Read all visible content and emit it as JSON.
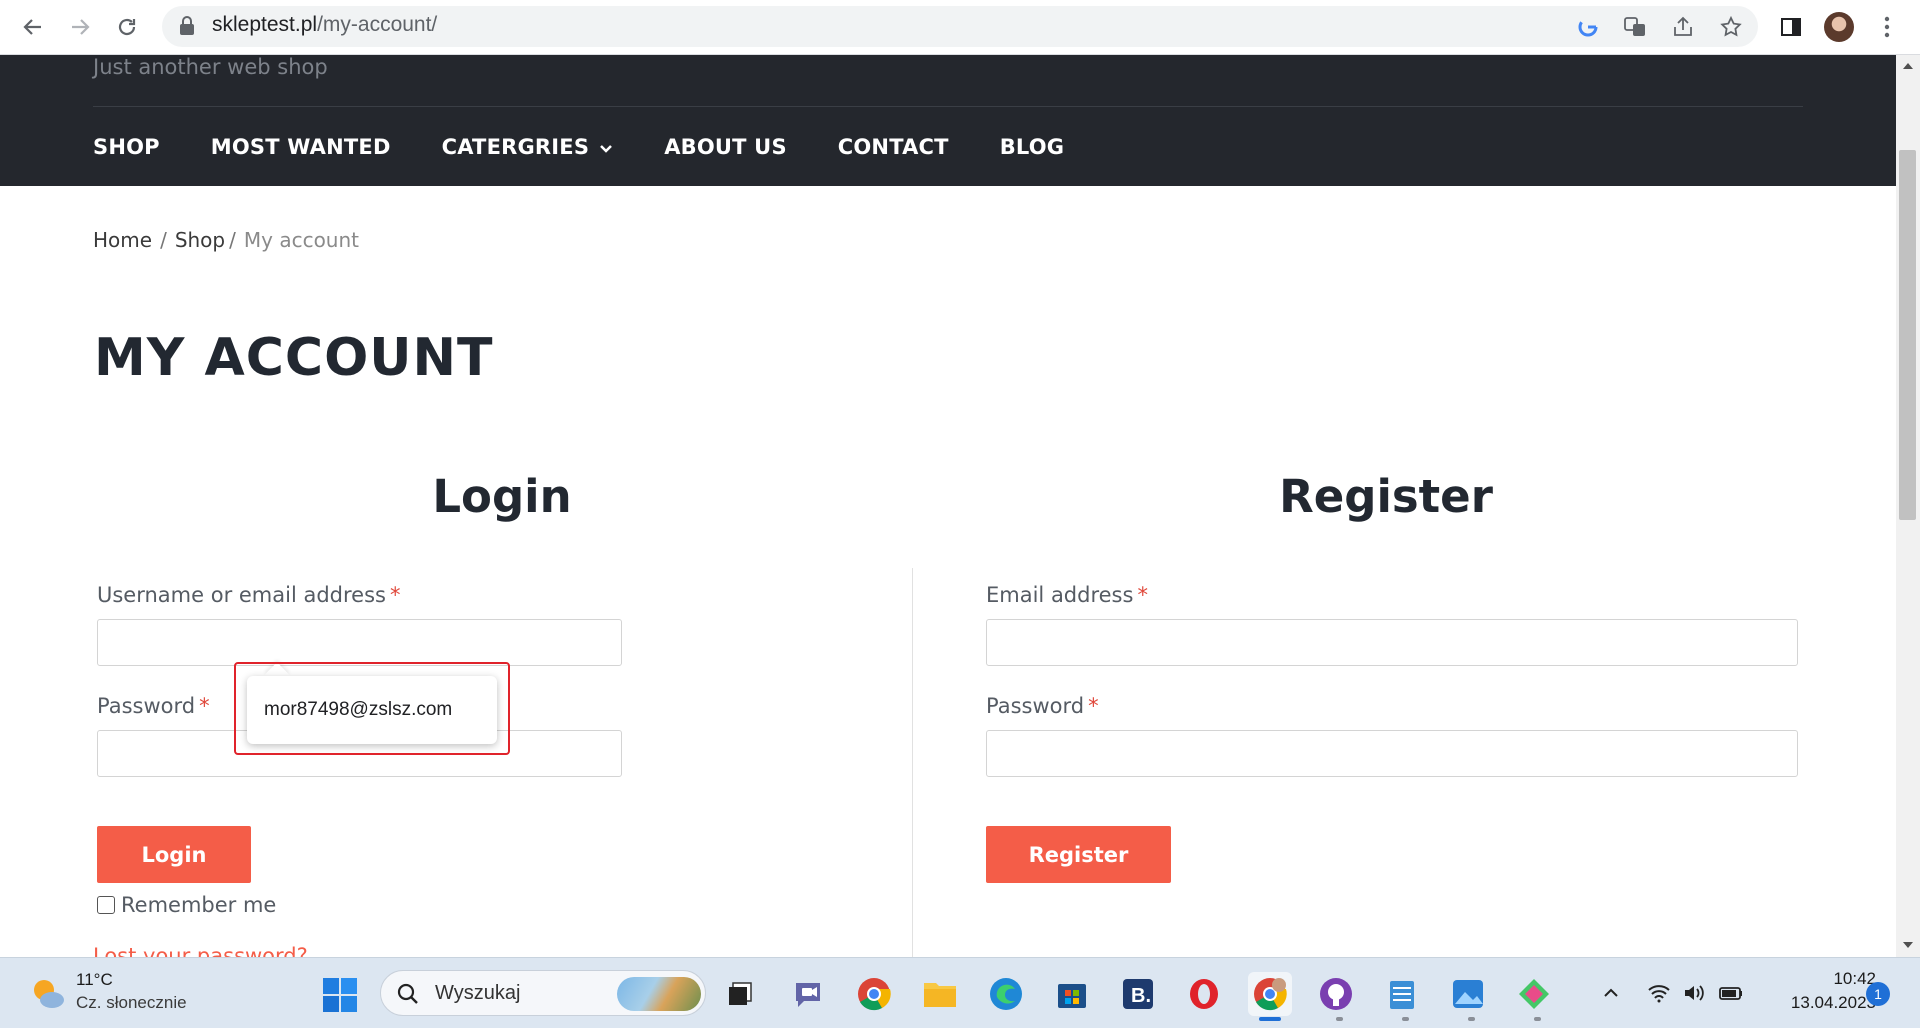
{
  "browser": {
    "url_host": "skleptest.pl",
    "url_path": "/my-account/"
  },
  "site": {
    "tagline": "Just another web shop",
    "nav": [
      {
        "label": "SHOP"
      },
      {
        "label": "MOST WANTED"
      },
      {
        "label": "CATERGRIES"
      },
      {
        "label": "ABOUT US"
      },
      {
        "label": "CONTACT"
      },
      {
        "label": "BLOG"
      }
    ]
  },
  "breadcrumb": {
    "home": "Home",
    "sep1": "/",
    "shop": "Shop",
    "sep2": "/",
    "current": "My account"
  },
  "page": {
    "title": "MY ACCOUNT"
  },
  "login": {
    "heading": "Login",
    "username_label": "Username or email address",
    "password_label": "Password",
    "required_mark": "*",
    "button": "Login",
    "remember": "Remember me",
    "lost_password": "Lost your password?",
    "autofill_suggestion": "mor87498@zslsz.com"
  },
  "register": {
    "heading": "Register",
    "email_label": "Email address",
    "password_label": "Password",
    "required_mark": "*",
    "button": "Register"
  },
  "taskbar": {
    "weather_temp": "11°C",
    "weather_desc": "Cz. słonecznie",
    "search_placeholder": "Wyszukaj",
    "time": "10:42",
    "date": "13.04.2023",
    "notifications": "1"
  },
  "colors": {
    "header_bg": "#24272d",
    "accent": "#f45d48",
    "highlight": "#e0232b"
  }
}
